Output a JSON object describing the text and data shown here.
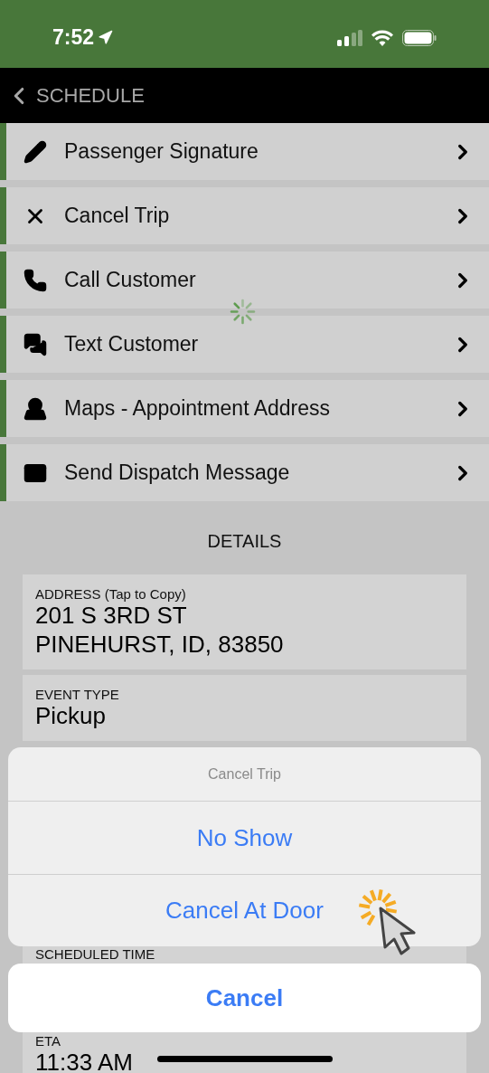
{
  "status_bar": {
    "time": "7:52"
  },
  "nav": {
    "back_label": "SCHEDULE"
  },
  "menu": [
    {
      "label": "Passenger Signature"
    },
    {
      "label": "Cancel Trip"
    },
    {
      "label": "Call Customer"
    },
    {
      "label": "Text Customer"
    },
    {
      "label": "Maps - Appointment Address"
    },
    {
      "label": "Send Dispatch Message"
    }
  ],
  "details": {
    "title": "DETAILS",
    "fields": [
      {
        "label": "ADDRESS (Tap to Copy)",
        "value": "201 S 3RD ST\nPINEHURST, ID, 83850"
      },
      {
        "label": "EVENT TYPE",
        "value": "Pickup"
      },
      {
        "label": "SCHEDULED TIME"
      },
      {
        "label": "ETA",
        "value": "11:33 AM"
      }
    ]
  },
  "action_sheet": {
    "title": "Cancel Trip",
    "actions": [
      "No Show",
      "Cancel At Door"
    ],
    "cancel": "Cancel"
  }
}
